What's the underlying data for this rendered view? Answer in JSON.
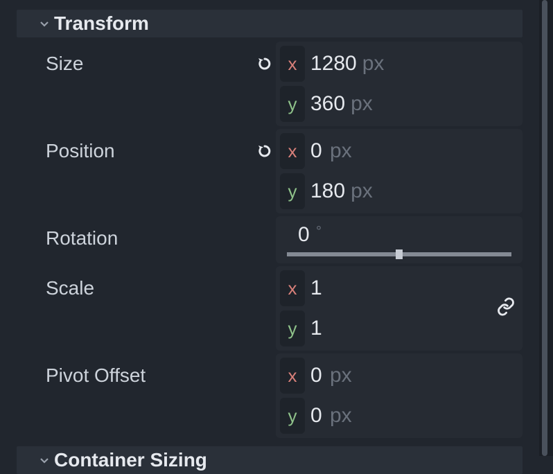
{
  "sections": {
    "transform": {
      "title": "Transform"
    },
    "container_sizing": {
      "title": "Container Sizing"
    }
  },
  "transform": {
    "size": {
      "label": "Size",
      "x": "1280",
      "y": "360",
      "unit": "px"
    },
    "position": {
      "label": "Position",
      "x": "0",
      "y": "180",
      "unit": "px"
    },
    "rotation": {
      "label": "Rotation",
      "value": "0",
      "unit": "°"
    },
    "scale": {
      "label": "Scale",
      "x": "1",
      "y": "1"
    },
    "pivot_offset": {
      "label": "Pivot Offset",
      "x": "0",
      "y": "0",
      "unit": "px"
    }
  },
  "axis": {
    "x": "x",
    "y": "y"
  }
}
